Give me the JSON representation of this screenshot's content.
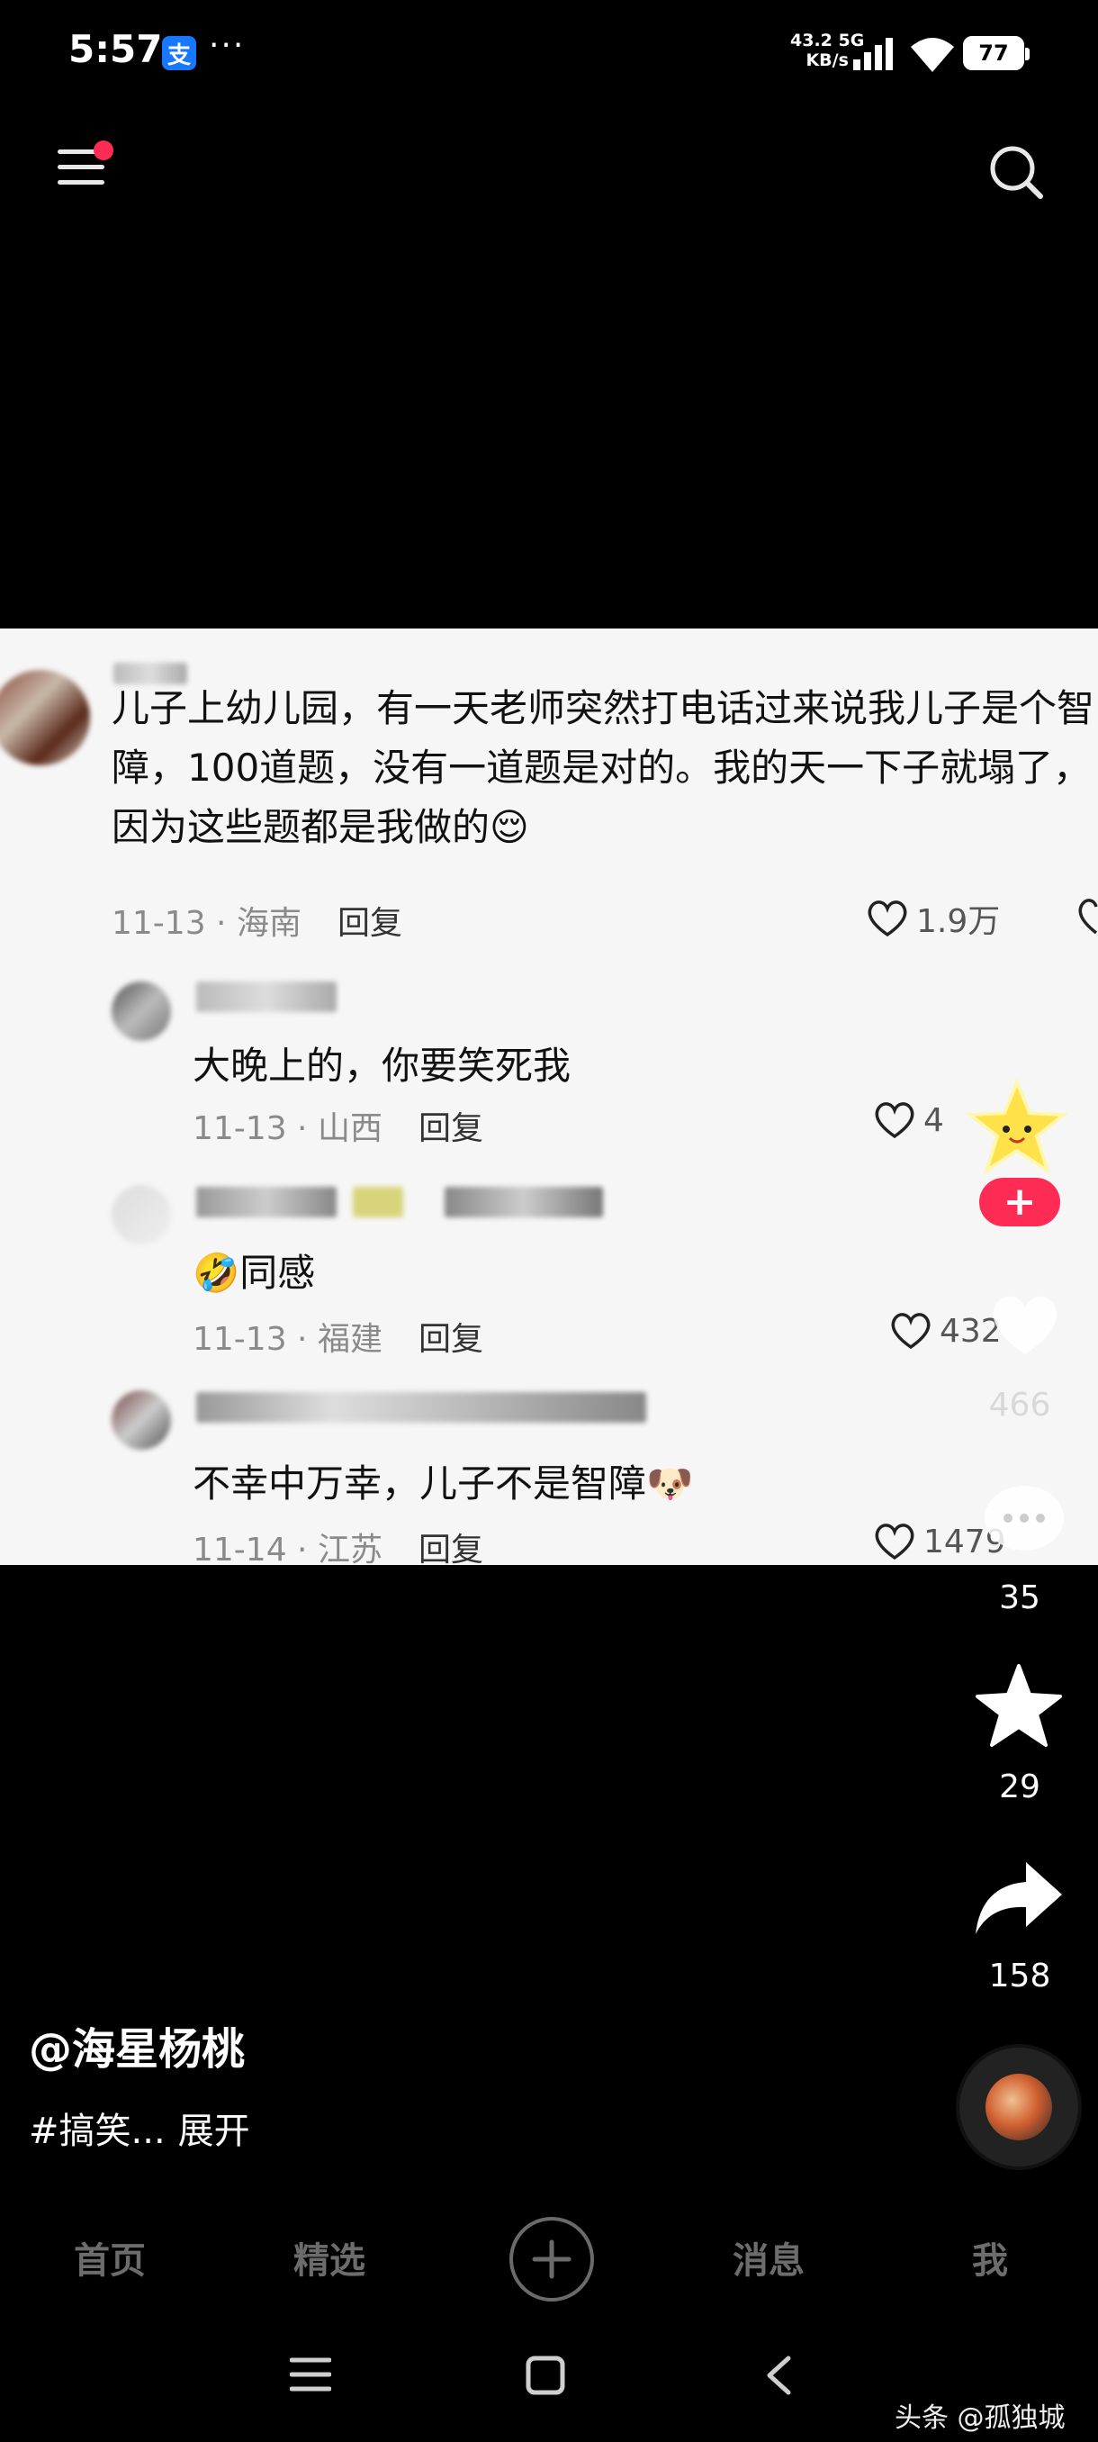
{
  "status_bar": {
    "time": "5:57",
    "alipay_glyph": "支",
    "more_glyph": "···",
    "net_speed_value": "43.2",
    "net_speed_unit": "KB/s",
    "network_type": "5G",
    "battery": "77"
  },
  "top_nav": {
    "menu_icon": "hamburger-menu-icon",
    "notification_dot_color": "#fe2c55",
    "search_icon": "search-icon"
  },
  "comments": {
    "main": {
      "text": "儿子上幼儿园，有一天老师突然打电话过来说我儿子是个智障，100道题，没有一道题是对的。我的天一下子就塌了，因为这些题都是我做的",
      "emoji": "😌",
      "date": "11-13",
      "location": "海南",
      "reply_label": "回复",
      "likes": "1.9万"
    },
    "replies": [
      {
        "text": "大晚上的，你要笑死我",
        "date": "11-13",
        "location": "山西",
        "reply_label": "回复",
        "likes": "4"
      },
      {
        "emoji": "🤣",
        "text": "同感",
        "date": "11-13",
        "location": "福建",
        "reply_label": "回复",
        "likes": "432"
      },
      {
        "text": "不幸中万幸，儿子不是智障",
        "emoji": "🐶",
        "date": "11-14",
        "location": "江苏",
        "reply_label": "回复",
        "likes": "1479"
      }
    ]
  },
  "side_actions": {
    "follow_symbol": "+",
    "likes_count": "466",
    "comments_count": "35",
    "favorites_count": "29",
    "shares_count": "158"
  },
  "caption": {
    "author": "@海星杨桃",
    "hashtag": "#搞笑...",
    "expand": "展开"
  },
  "tabs": [
    {
      "label": "首页"
    },
    {
      "label": "精选"
    },
    {
      "label": "消息"
    },
    {
      "label": "我"
    }
  ],
  "watermark": "头条 @孤独城",
  "colors": {
    "accent": "#fe2c55",
    "panel_bg": "#f6f6f6",
    "tab_inactive": "#6c6c6c"
  }
}
